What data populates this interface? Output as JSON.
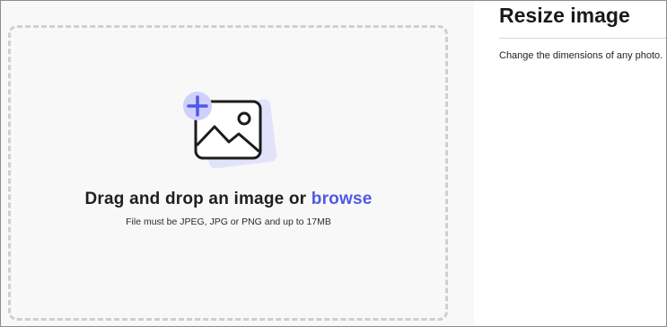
{
  "upload": {
    "heading_prefix": "Drag and drop an image or ",
    "browse_label": "browse",
    "hint": "File must be JPEG, JPG or PNG and up to 17MB",
    "illustration_icon": "add-image-icon"
  },
  "side": {
    "title": "Resize image",
    "subtitle": "Change the dimensions of any photo."
  },
  "colors": {
    "accent": "#5258e4",
    "accent_light": "#cfd0fb",
    "panel_bg": "#f8f8f8",
    "dashed_border": "#cfcfcf"
  }
}
